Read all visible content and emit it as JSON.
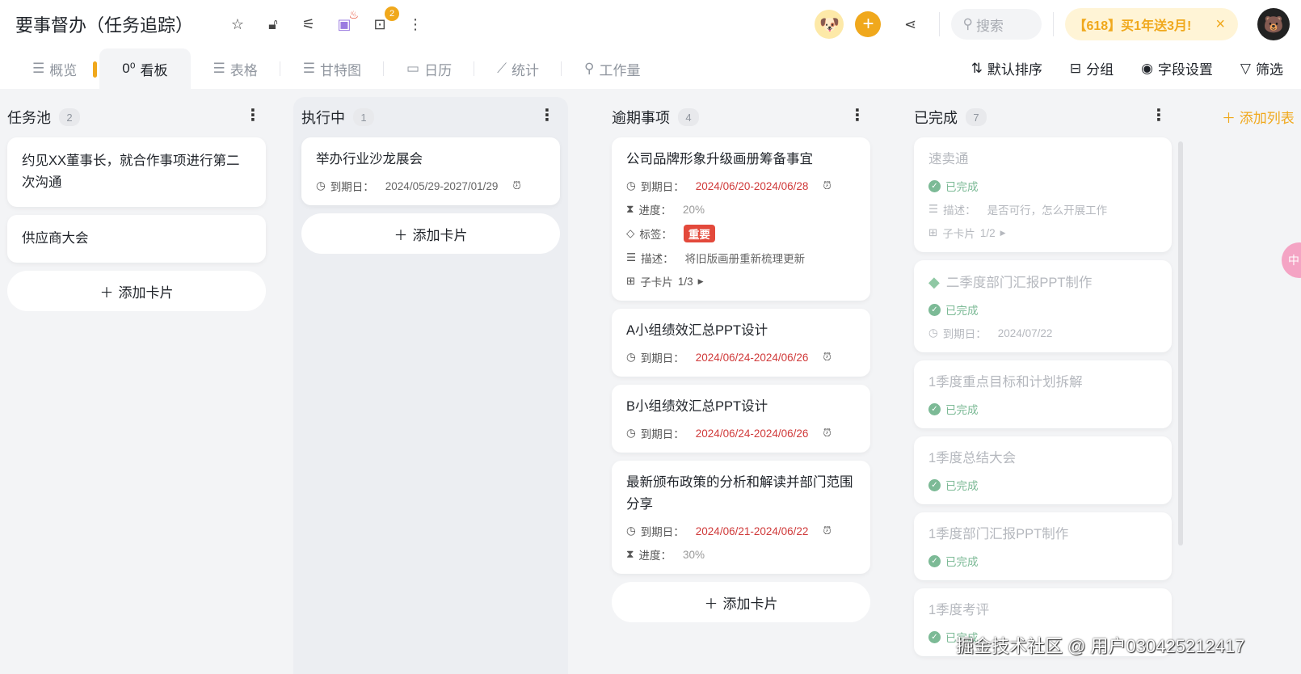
{
  "header": {
    "title": "要事督办（任务追踪）",
    "bot_badge": "2",
    "search_placeholder": "搜索",
    "promo": "【618】买1年送3月!",
    "promo_close": "×"
  },
  "tabs": [
    {
      "label": "概览",
      "icon": "☰"
    },
    {
      "label": "看板",
      "icon": "0⁰"
    },
    {
      "label": "表格",
      "icon": "☰"
    },
    {
      "label": "甘特图",
      "icon": "☰"
    },
    {
      "label": "日历",
      "icon": "▭"
    },
    {
      "label": "统计",
      "icon": "⟋"
    },
    {
      "label": "工作量",
      "icon": "⚲"
    }
  ],
  "tools": {
    "sort": "默认排序",
    "group": "分组",
    "fields": "字段设置",
    "filter": "筛选"
  },
  "labels": {
    "due": "到期日：",
    "progress": "进度：",
    "tag": "标签：",
    "desc": "描述：",
    "sub": "子卡片",
    "done": "已完成",
    "add_card": "添加卡片",
    "add_list": "添加列表"
  },
  "columns": [
    {
      "name": "任务池",
      "count": "2",
      "cards": [
        {
          "title": "约见XX董事长，就合作事项进行第二次沟通"
        },
        {
          "title": "供应商大会"
        }
      ]
    },
    {
      "name": "执行中",
      "count": "1",
      "cards": [
        {
          "title": "举办行业沙龙展会",
          "due": "2024/05/29-2027/01/29"
        }
      ]
    },
    {
      "name": "逾期事项",
      "count": "4",
      "cards": [
        {
          "title": "公司品牌形象升级画册筹备事宜",
          "due": "2024/06/20-2024/06/28",
          "progress": "20%",
          "tag": "重要",
          "desc": "将旧版画册重新梳理更新",
          "sub": "1/3"
        },
        {
          "title": "A小组绩效汇总PPT设计",
          "due": "2024/06/24-2024/06/26"
        },
        {
          "title": "B小组绩效汇总PPT设计",
          "due": "2024/06/24-2024/06/26"
        },
        {
          "title": "最新颁布政策的分析和解读并部门范围分享",
          "due": "2024/06/21-2024/06/22",
          "progress": "30%"
        }
      ]
    },
    {
      "name": "已完成",
      "count": "7",
      "cards": [
        {
          "title": "速卖通",
          "desc": "是否可行，怎么开展工作",
          "sub": "1/2"
        },
        {
          "title": "二季度部门汇报PPT制作",
          "due": "2024/07/22"
        },
        {
          "title": "1季度重点目标和计划拆解"
        },
        {
          "title": "1季度总结大会"
        },
        {
          "title": "1季度部门汇报PPT制作"
        },
        {
          "title": "1季度考评"
        }
      ]
    }
  ],
  "float_label": "中",
  "watermark": "掘金技术社区 @ 用户030425212417"
}
